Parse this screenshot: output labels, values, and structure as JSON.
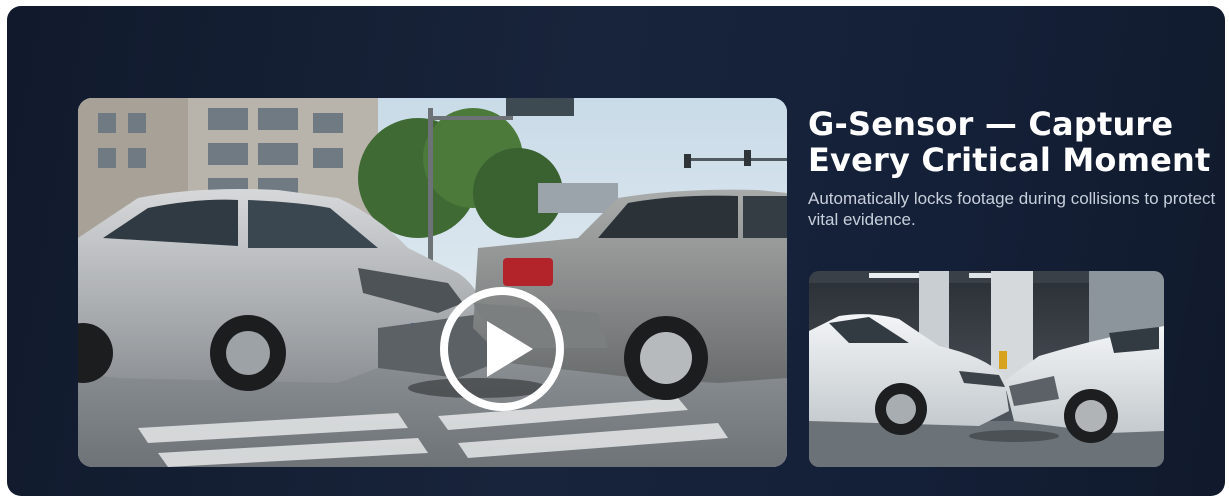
{
  "feature": {
    "headline_line1": "G-Sensor — Capture",
    "headline_line2": "Every Critical Moment",
    "description": "Automatically locks footage during collisions to protect vital evidence."
  },
  "video": {
    "play_icon": "play-circle-icon"
  },
  "colors": {
    "panel_background": "#16213a",
    "headline": "#ffffff",
    "description": "#c7cfdb"
  }
}
